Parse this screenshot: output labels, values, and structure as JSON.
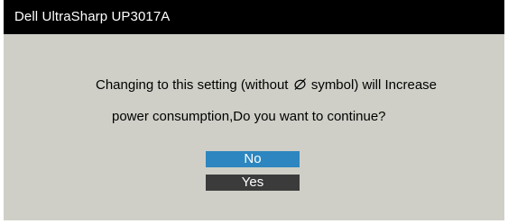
{
  "window": {
    "title": "Dell UltraSharp UP3017A"
  },
  "message": {
    "line1_before": "Changing to this setting (without",
    "symbol_icon": "no-energy-symbol-icon",
    "line1_after": "symbol) will Increase",
    "line2": "power consumption,Do you want to continue?"
  },
  "buttons": {
    "no_label": "No",
    "yes_label": "Yes"
  },
  "colors": {
    "titlebar": "#000000",
    "background": "#cfcfc8",
    "selected_button": "#2d86bf",
    "button": "#3b3b3b"
  }
}
